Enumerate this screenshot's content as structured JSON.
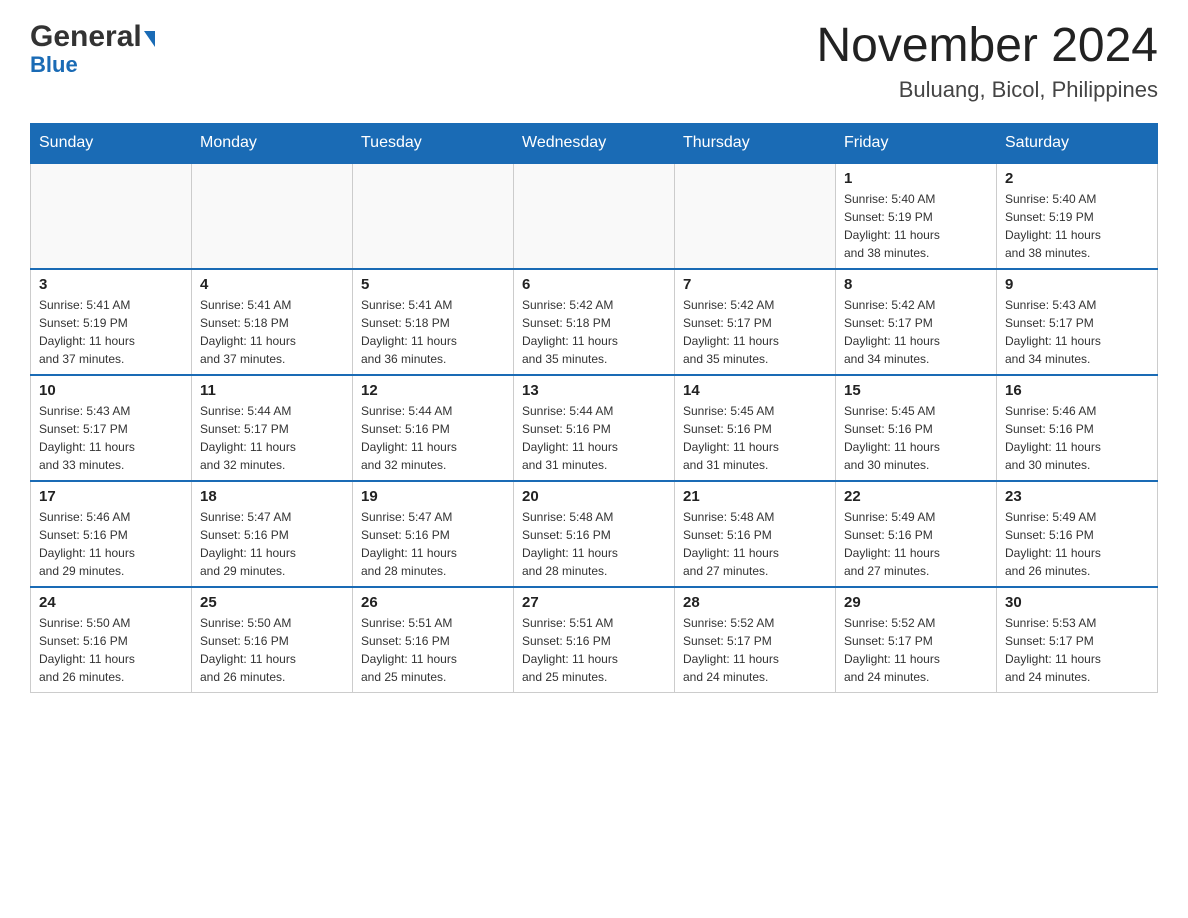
{
  "header": {
    "logo_general": "General",
    "logo_blue": "Blue",
    "title": "November 2024",
    "subtitle": "Buluang, Bicol, Philippines"
  },
  "days_of_week": [
    "Sunday",
    "Monday",
    "Tuesday",
    "Wednesday",
    "Thursday",
    "Friday",
    "Saturday"
  ],
  "weeks": [
    {
      "days": [
        {
          "number": "",
          "info": ""
        },
        {
          "number": "",
          "info": ""
        },
        {
          "number": "",
          "info": ""
        },
        {
          "number": "",
          "info": ""
        },
        {
          "number": "",
          "info": ""
        },
        {
          "number": "1",
          "info": "Sunrise: 5:40 AM\nSunset: 5:19 PM\nDaylight: 11 hours\nand 38 minutes."
        },
        {
          "number": "2",
          "info": "Sunrise: 5:40 AM\nSunset: 5:19 PM\nDaylight: 11 hours\nand 38 minutes."
        }
      ]
    },
    {
      "days": [
        {
          "number": "3",
          "info": "Sunrise: 5:41 AM\nSunset: 5:19 PM\nDaylight: 11 hours\nand 37 minutes."
        },
        {
          "number": "4",
          "info": "Sunrise: 5:41 AM\nSunset: 5:18 PM\nDaylight: 11 hours\nand 37 minutes."
        },
        {
          "number": "5",
          "info": "Sunrise: 5:41 AM\nSunset: 5:18 PM\nDaylight: 11 hours\nand 36 minutes."
        },
        {
          "number": "6",
          "info": "Sunrise: 5:42 AM\nSunset: 5:18 PM\nDaylight: 11 hours\nand 35 minutes."
        },
        {
          "number": "7",
          "info": "Sunrise: 5:42 AM\nSunset: 5:17 PM\nDaylight: 11 hours\nand 35 minutes."
        },
        {
          "number": "8",
          "info": "Sunrise: 5:42 AM\nSunset: 5:17 PM\nDaylight: 11 hours\nand 34 minutes."
        },
        {
          "number": "9",
          "info": "Sunrise: 5:43 AM\nSunset: 5:17 PM\nDaylight: 11 hours\nand 34 minutes."
        }
      ]
    },
    {
      "days": [
        {
          "number": "10",
          "info": "Sunrise: 5:43 AM\nSunset: 5:17 PM\nDaylight: 11 hours\nand 33 minutes."
        },
        {
          "number": "11",
          "info": "Sunrise: 5:44 AM\nSunset: 5:17 PM\nDaylight: 11 hours\nand 32 minutes."
        },
        {
          "number": "12",
          "info": "Sunrise: 5:44 AM\nSunset: 5:16 PM\nDaylight: 11 hours\nand 32 minutes."
        },
        {
          "number": "13",
          "info": "Sunrise: 5:44 AM\nSunset: 5:16 PM\nDaylight: 11 hours\nand 31 minutes."
        },
        {
          "number": "14",
          "info": "Sunrise: 5:45 AM\nSunset: 5:16 PM\nDaylight: 11 hours\nand 31 minutes."
        },
        {
          "number": "15",
          "info": "Sunrise: 5:45 AM\nSunset: 5:16 PM\nDaylight: 11 hours\nand 30 minutes."
        },
        {
          "number": "16",
          "info": "Sunrise: 5:46 AM\nSunset: 5:16 PM\nDaylight: 11 hours\nand 30 minutes."
        }
      ]
    },
    {
      "days": [
        {
          "number": "17",
          "info": "Sunrise: 5:46 AM\nSunset: 5:16 PM\nDaylight: 11 hours\nand 29 minutes."
        },
        {
          "number": "18",
          "info": "Sunrise: 5:47 AM\nSunset: 5:16 PM\nDaylight: 11 hours\nand 29 minutes."
        },
        {
          "number": "19",
          "info": "Sunrise: 5:47 AM\nSunset: 5:16 PM\nDaylight: 11 hours\nand 28 minutes."
        },
        {
          "number": "20",
          "info": "Sunrise: 5:48 AM\nSunset: 5:16 PM\nDaylight: 11 hours\nand 28 minutes."
        },
        {
          "number": "21",
          "info": "Sunrise: 5:48 AM\nSunset: 5:16 PM\nDaylight: 11 hours\nand 27 minutes."
        },
        {
          "number": "22",
          "info": "Sunrise: 5:49 AM\nSunset: 5:16 PM\nDaylight: 11 hours\nand 27 minutes."
        },
        {
          "number": "23",
          "info": "Sunrise: 5:49 AM\nSunset: 5:16 PM\nDaylight: 11 hours\nand 26 minutes."
        }
      ]
    },
    {
      "days": [
        {
          "number": "24",
          "info": "Sunrise: 5:50 AM\nSunset: 5:16 PM\nDaylight: 11 hours\nand 26 minutes."
        },
        {
          "number": "25",
          "info": "Sunrise: 5:50 AM\nSunset: 5:16 PM\nDaylight: 11 hours\nand 26 minutes."
        },
        {
          "number": "26",
          "info": "Sunrise: 5:51 AM\nSunset: 5:16 PM\nDaylight: 11 hours\nand 25 minutes."
        },
        {
          "number": "27",
          "info": "Sunrise: 5:51 AM\nSunset: 5:16 PM\nDaylight: 11 hours\nand 25 minutes."
        },
        {
          "number": "28",
          "info": "Sunrise: 5:52 AM\nSunset: 5:17 PM\nDaylight: 11 hours\nand 24 minutes."
        },
        {
          "number": "29",
          "info": "Sunrise: 5:52 AM\nSunset: 5:17 PM\nDaylight: 11 hours\nand 24 minutes."
        },
        {
          "number": "30",
          "info": "Sunrise: 5:53 AM\nSunset: 5:17 PM\nDaylight: 11 hours\nand 24 minutes."
        }
      ]
    }
  ]
}
